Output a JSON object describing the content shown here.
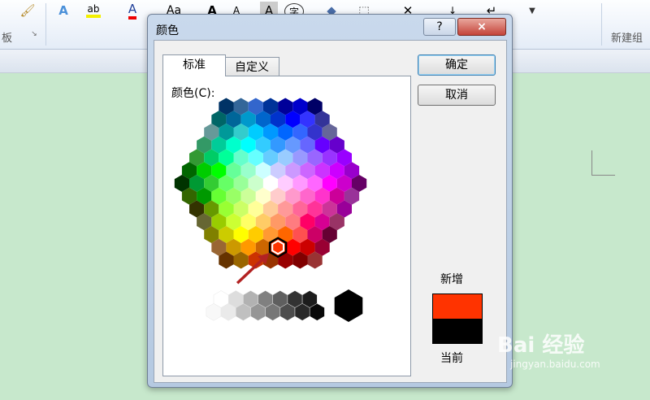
{
  "ribbon": {
    "clipboard_group_label": "板",
    "new_group_label": "新建组",
    "glyphs": {
      "font_a": "A",
      "aa": "Aa",
      "big_a": "A",
      "small_a": "A",
      "char_a": "A",
      "char_circle": "字"
    }
  },
  "dialog": {
    "title": "颜色",
    "help_label": "?",
    "close_label": "×",
    "tabs": [
      {
        "label": "标准",
        "selected": true
      },
      {
        "label": "自定义",
        "selected": false
      }
    ],
    "colors_label": "颜色(C):",
    "ok_label": "确定",
    "cancel_label": "取消",
    "new_label": "新增",
    "current_label": "当前",
    "new_color": "#ff3300",
    "current_color": "#000000",
    "selected_color": "#ff3300"
  },
  "palette": {
    "rows": [
      [
        "#003366",
        "#336699",
        "#3366cc",
        "#003399",
        "#000099",
        "#0000cc",
        "#000066"
      ],
      [
        "#006666",
        "#006699",
        "#0099cc",
        "#0066cc",
        "#0033cc",
        "#0000ff",
        "#3333ff",
        "#333399"
      ],
      [
        "#669999",
        "#009999",
        "#33cccc",
        "#00ccff",
        "#0099ff",
        "#0066ff",
        "#3366ff",
        "#3333cc",
        "#666699"
      ],
      [
        "#339966",
        "#00cc99",
        "#00ffcc",
        "#00ffff",
        "#33ccff",
        "#3399ff",
        "#6699ff",
        "#6666ff",
        "#6600ff",
        "#6600cc"
      ],
      [
        "#339933",
        "#00cc66",
        "#00ff99",
        "#66ffcc",
        "#66ffff",
        "#66ccff",
        "#99ccff",
        "#9999ff",
        "#9966ff",
        "#9933ff",
        "#9900ff"
      ],
      [
        "#006600",
        "#00cc00",
        "#00ff00",
        "#66ff99",
        "#99ffcc",
        "#ccffff",
        "#ccccff",
        "#cc99ff",
        "#cc66ff",
        "#cc33ff",
        "#cc00ff",
        "#9900cc"
      ],
      [
        "#003300",
        "#009933",
        "#33cc33",
        "#66ff66",
        "#99ff99",
        "#ccffcc",
        "#ffffff",
        "#ffccff",
        "#ff99ff",
        "#ff66ff",
        "#ff00ff",
        "#cc00cc",
        "#660066"
      ],
      [
        "#336600",
        "#009900",
        "#66ff33",
        "#99ff66",
        "#ccff99",
        "#ffffcc",
        "#ffcccc",
        "#ff99cc",
        "#ff66cc",
        "#ff33cc",
        "#cc0099",
        "#993399"
      ],
      [
        "#333300",
        "#669900",
        "#99ff33",
        "#ccff66",
        "#ffff99",
        "#ffcc99",
        "#ff9999",
        "#ff6699",
        "#ff3399",
        "#cc3399",
        "#990099"
      ],
      [
        "#666633",
        "#99cc00",
        "#ccff33",
        "#ffff66",
        "#ffcc66",
        "#ff9966",
        "#ff7c80",
        "#ff0066",
        "#d60093",
        "#993366"
      ],
      [
        "#808000",
        "#cccc00",
        "#ffff00",
        "#ffcc00",
        "#ff9933",
        "#ff6600",
        "#ff5050",
        "#cc0066",
        "#660033"
      ],
      [
        "#996633",
        "#cc9900",
        "#ff9900",
        "#cc6600",
        "#ff3300",
        "#ff0000",
        "#cc0000",
        "#990033"
      ],
      [
        "#663300",
        "#996600",
        "#cc3300",
        "#993300",
        "#990000",
        "#800000",
        "#993333"
      ]
    ],
    "grays": [
      [
        "#ffffff",
        "#dddddd",
        "#b2b2b2",
        "#808080",
        "#5f5f5f",
        "#333333",
        "#1c1c1c"
      ],
      [
        "#f8f8f8",
        "#eaeaea",
        "#c0c0c0",
        "#969696",
        "#777777",
        "#4d4d4d",
        "#292929",
        "#080808"
      ]
    ],
    "black": "#000000"
  },
  "watermark": {
    "logo": "Bai 经验",
    "url": "jingyan.baidu.com"
  }
}
